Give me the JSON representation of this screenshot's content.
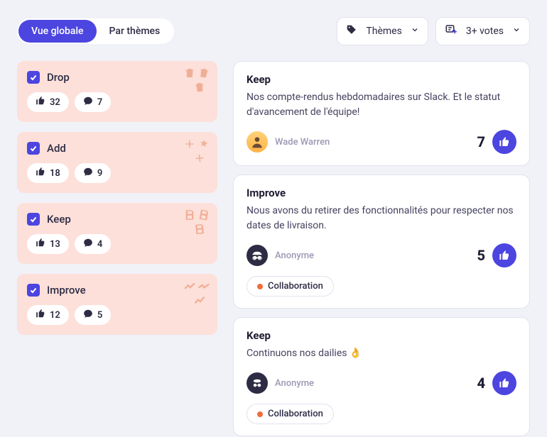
{
  "tabs": {
    "global": "Vue globale",
    "themes": "Par thèmes"
  },
  "filters": {
    "themes_label": "Thèmes",
    "votes_label": "3+ votes"
  },
  "categories": [
    {
      "name": "Drop",
      "likes": "32",
      "comments": "7"
    },
    {
      "name": "Add",
      "likes": "18",
      "comments": "9"
    },
    {
      "name": "Keep",
      "likes": "13",
      "comments": "4"
    },
    {
      "name": "Improve",
      "likes": "12",
      "comments": "5"
    }
  ],
  "cards": [
    {
      "title": "Keep",
      "body": "Nos compte-rendus hebdomadaires sur Slack. Et le statut d'avancement de l'équipe!",
      "author": "Wade Warren",
      "author_type": "photo",
      "votes": "7",
      "tags": []
    },
    {
      "title": "Improve",
      "body": "Nous avons du retirer des fonctionnalités pour respecter nos dates de livraison.",
      "author": "Anonyme",
      "author_type": "anon",
      "votes": "5",
      "tags": [
        {
          "label": "Collaboration",
          "dot": "#F06C3A"
        }
      ]
    },
    {
      "title": "Keep",
      "body": "Continuons nos dailies 👌",
      "author": "Anonyme",
      "author_type": "anon",
      "votes": "4",
      "tags": [
        {
          "label": "Collaboration",
          "dot": "#F06C3A"
        }
      ]
    }
  ]
}
